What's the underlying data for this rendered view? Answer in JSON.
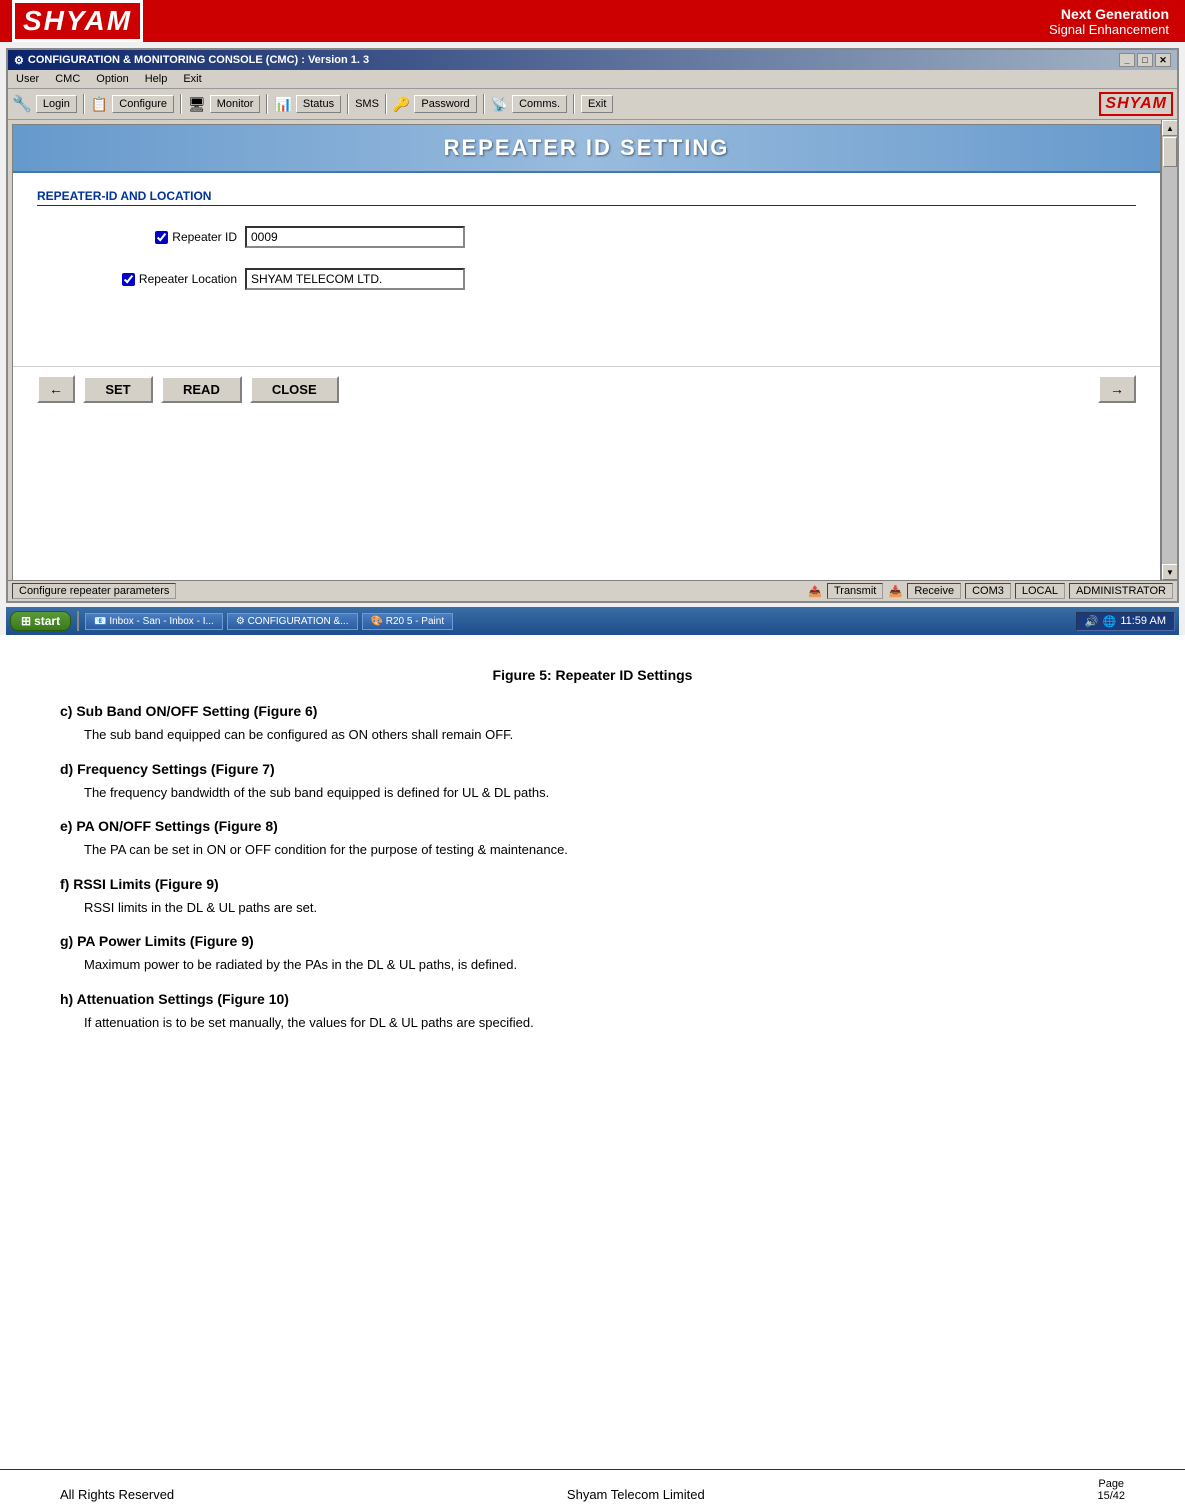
{
  "header": {
    "logo": "SHYAM",
    "tagline_line1": "Next Generation",
    "tagline_line2": "Signal Enhancement"
  },
  "window": {
    "title": "CONFIGURATION & MONITORING CONSOLE (CMC)  :  Version 1. 3",
    "title_icon": "⚙",
    "controls": [
      "_",
      "□",
      "✕"
    ]
  },
  "menu": {
    "items": [
      "User",
      "CMC",
      "Option",
      "Help",
      "Exit"
    ]
  },
  "toolbar": {
    "login_label": "Login",
    "configure_label": "Configure",
    "monitor_label": "Monitor",
    "status_label": "Status",
    "sms_label": "SMS",
    "password_label": "Password",
    "comms_label": "Comms.",
    "exit_label": "Exit",
    "logo": "SHYAM"
  },
  "repeater_id_setting": {
    "title": "REPEATER ID SETTING",
    "section_title": "REPEATER-ID AND LOCATION",
    "repeater_id_label": "Repeater ID",
    "repeater_id_checked": true,
    "repeater_id_value": "0009",
    "repeater_location_label": "Repeater Location",
    "repeater_location_checked": true,
    "repeater_location_value": "SHYAM TELECOM LTD.",
    "btn_set": "SET",
    "btn_read": "READ",
    "btn_close": "CLOSE",
    "back_arrow": "←",
    "fwd_arrow": "→"
  },
  "status_bar": {
    "config_text": "Configure repeater parameters",
    "transmit_label": "Transmit",
    "receive_label": "Receive",
    "com_label": "COM3",
    "local_label": "LOCAL",
    "admin_label": "ADMINISTRATOR"
  },
  "taskbar": {
    "start_label": "start",
    "item1": "Inbox - San - Inbox - I...",
    "item2": "CONFIGURATION &...",
    "item3": "R20 5 - Paint",
    "time": "11:59 AM"
  },
  "figure_caption": "Figure 5: Repeater ID Settings",
  "sections": [
    {
      "id": "c",
      "heading": "c) Sub Band ON/OFF Setting (Figure 6)",
      "body": "The sub band equipped can be configured as ON others shall remain OFF."
    },
    {
      "id": "d",
      "heading": "d) Frequency Settings (Figure 7)",
      "body": "The frequency bandwidth of the sub band equipped is defined for UL & DL paths."
    },
    {
      "id": "e",
      "heading": "e) PA ON/OFF Settings (Figure 8)",
      "body": "The PA can be set in ON or OFF condition for the purpose of testing & maintenance."
    },
    {
      "id": "f",
      "heading": "f) RSSI Limits (Figure 9)",
      "body": "RSSI limits in the DL & UL paths are set."
    },
    {
      "id": "g",
      "heading": "g) PA Power Limits (Figure 9)",
      "body": "Maximum power to be radiated by the PAs in the DL & UL paths, is defined."
    },
    {
      "id": "h",
      "heading": "h) Attenuation Settings (Figure 10)",
      "body": "If attenuation is to be set manually, the values for DL & UL paths are specified."
    }
  ],
  "footer": {
    "left": "All Rights Reserved",
    "center": "Shyam Telecom Limited",
    "right_label": "Page",
    "right_value": "15/42"
  }
}
